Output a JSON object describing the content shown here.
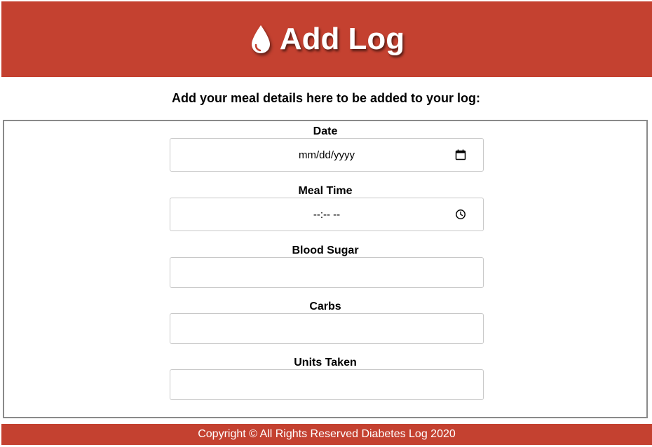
{
  "header": {
    "title": "Add Log",
    "icon": "blood-drop-icon",
    "background_color": "#c44130"
  },
  "subtitle": "Add your meal details here to be added to your log:",
  "form": {
    "fields": [
      {
        "label": "Date",
        "type": "date",
        "value": "mm/dd/yyyy",
        "icon": "calendar-icon"
      },
      {
        "label": "Meal Time",
        "type": "time",
        "value": "--:-- --",
        "icon": "clock-icon"
      },
      {
        "label": "Blood Sugar",
        "type": "text",
        "value": ""
      },
      {
        "label": "Carbs",
        "type": "text",
        "value": ""
      },
      {
        "label": "Units Taken",
        "type": "text",
        "value": ""
      }
    ]
  },
  "footer": {
    "text": "Copyright © All Rights Reserved Diabetes Log 2020",
    "background_color": "#c44130"
  }
}
